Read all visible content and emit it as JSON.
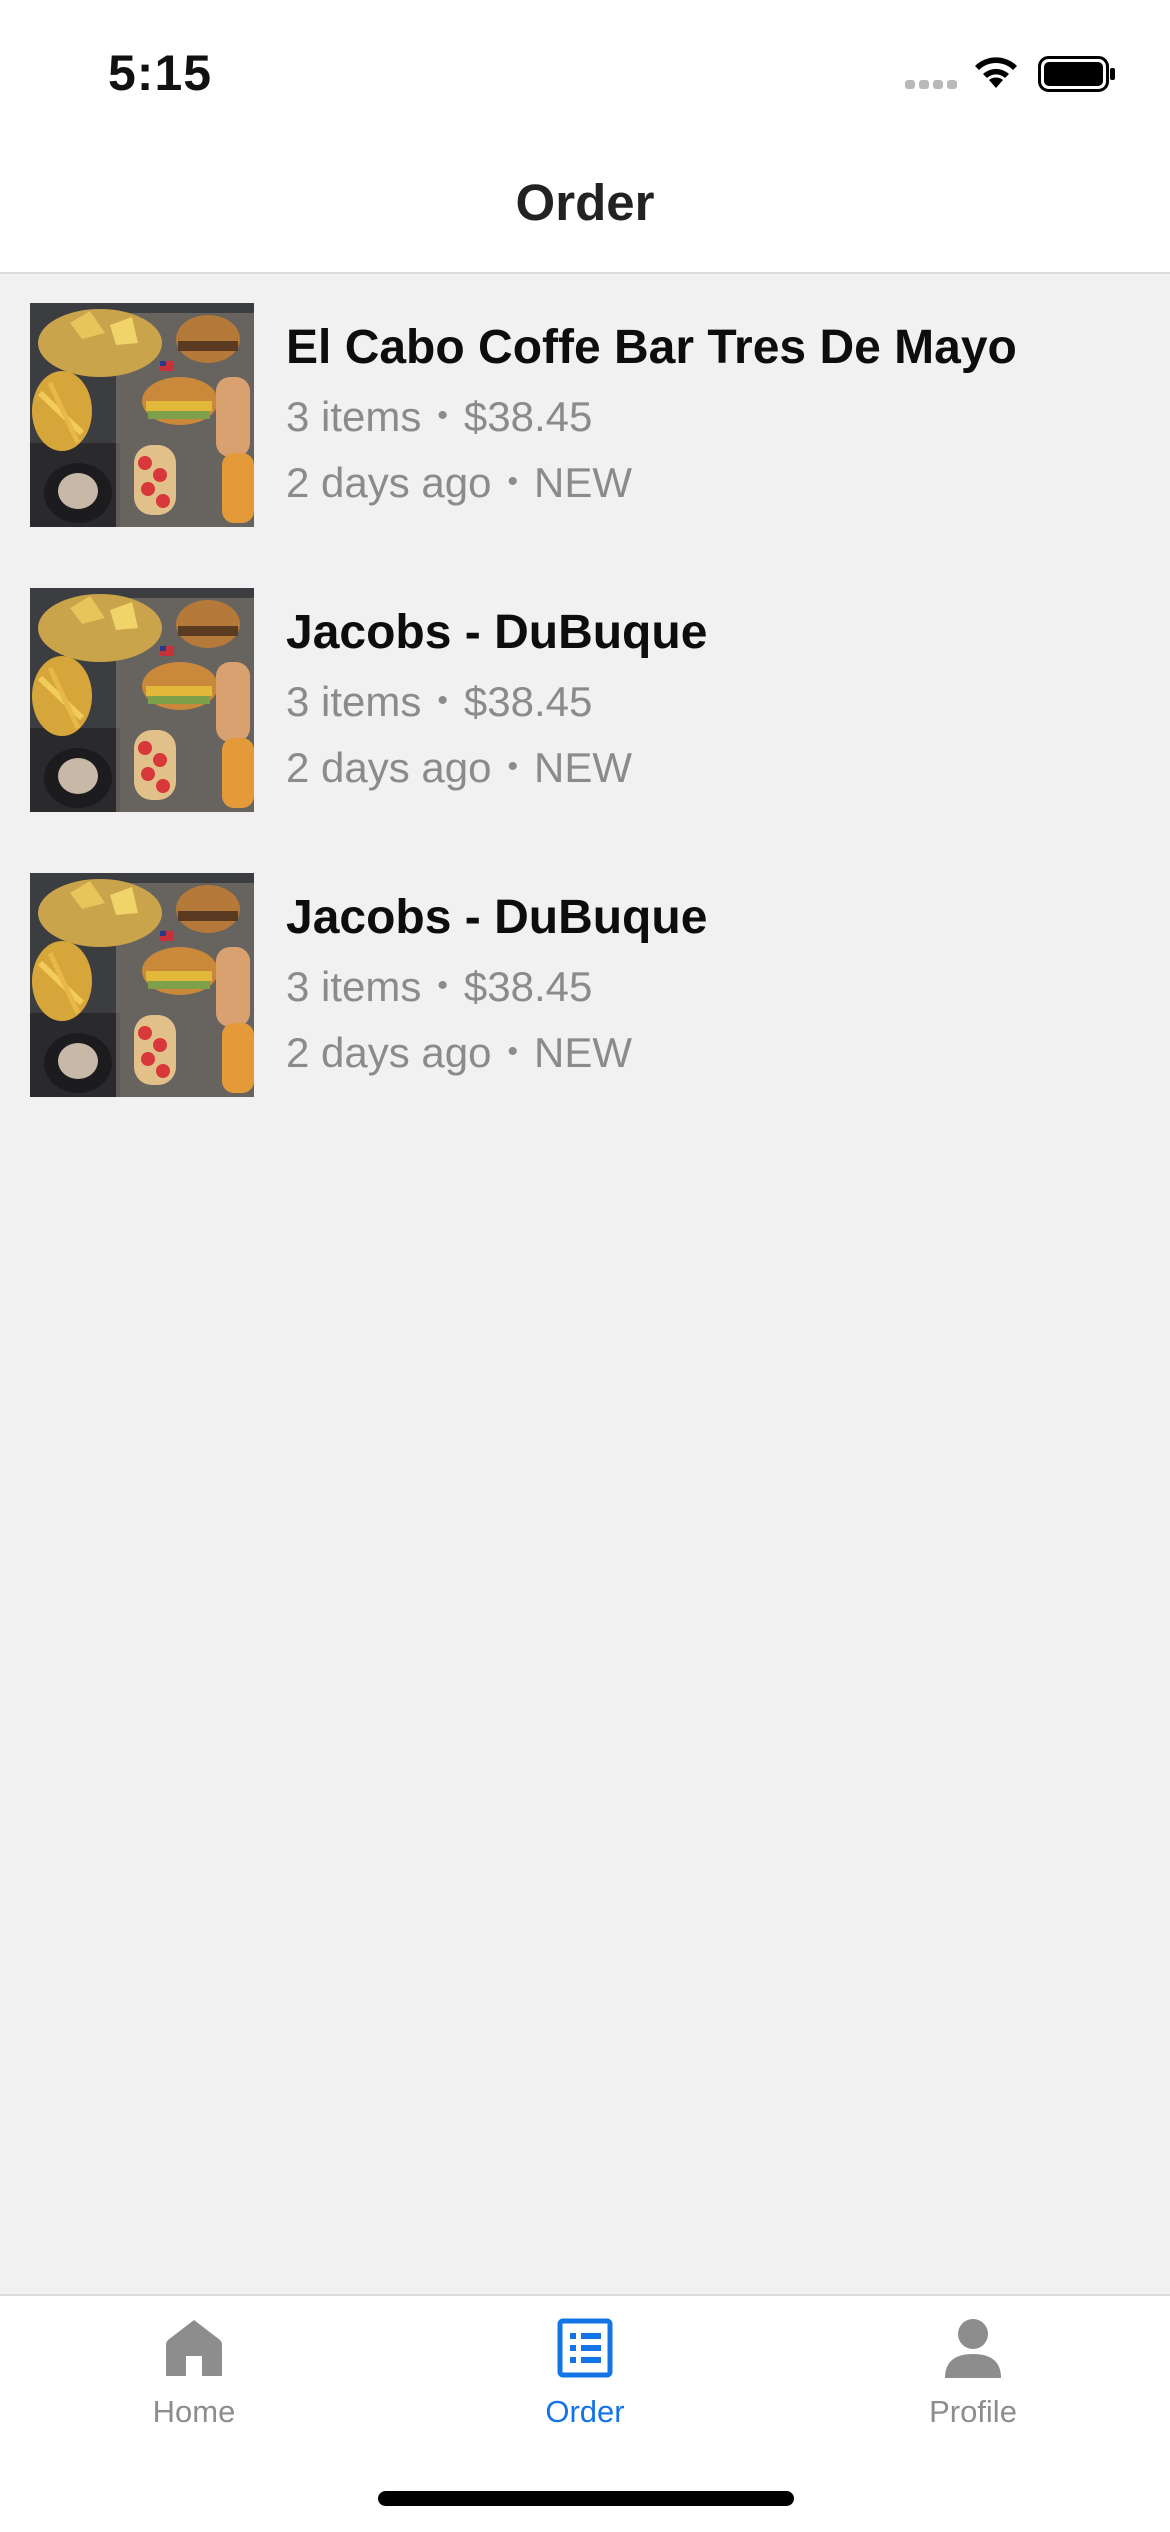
{
  "status_bar": {
    "time": "5:15",
    "icons": [
      "signal-dots-icon",
      "wifi-icon",
      "battery-icon"
    ]
  },
  "header": {
    "title": "Order"
  },
  "orders": [
    {
      "name": "El Cabo Coffe Bar Tres De Mayo",
      "items": "3 items",
      "price": "$38.45",
      "time_ago": "2 days ago",
      "status": "NEW"
    },
    {
      "name": "Jacobs - DuBuque",
      "items": "3 items",
      "price": "$38.45",
      "time_ago": "2 days ago",
      "status": "NEW"
    },
    {
      "name": "Jacobs - DuBuque",
      "items": "3 items",
      "price": "$38.45",
      "time_ago": "2 days ago",
      "status": "NEW"
    }
  ],
  "separator": "•",
  "tab_bar": {
    "tabs": [
      {
        "label": "Home",
        "icon": "home-icon",
        "active": false
      },
      {
        "label": "Order",
        "icon": "list-icon",
        "active": true
      },
      {
        "label": "Profile",
        "icon": "person-icon",
        "active": false
      }
    ]
  },
  "colors": {
    "accent": "#1473e6",
    "inactive": "#8d8d8d",
    "background": "#f1f1f1",
    "secondary_text": "#8b8b8b"
  }
}
